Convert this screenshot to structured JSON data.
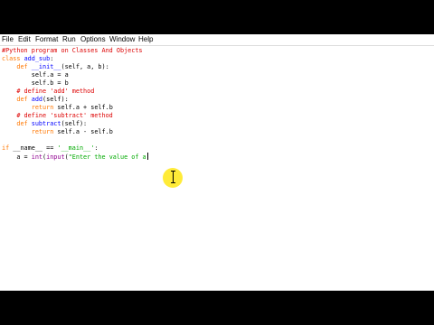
{
  "menu": {
    "items": [
      "File",
      "Edit",
      "Format",
      "Run",
      "Options",
      "Window",
      "Help"
    ]
  },
  "code": {
    "lines": [
      "#Python program on Classes And Objects",
      "class add_sub:",
      "    def __init__(self, a, b):",
      "        self.a = a",
      "        self.b = b",
      "    # define 'add' method",
      "    def add(self):",
      "        return self.a + self.b",
      "    # define 'subtract' method",
      "    def subtract(self):",
      "        return self.a - self.b",
      "",
      "if __name__ == '__main__':",
      "    a = int(input(\"Enter the value of a"
    ],
    "tokens": {
      "l0": "#Python program on Classes And Objects",
      "l1_kw": "class",
      "l1_name": "add_sub",
      "l1_rest": ":",
      "l2_indent": "    ",
      "l2_kw": "def",
      "l2_name": "__init__",
      "l2_rest": "(self, a, b):",
      "l3": "        self.a = a",
      "l4": "        self.b = b",
      "l5_indent": "    ",
      "l5_comment": "# define 'add' method",
      "l6_indent": "    ",
      "l6_kw": "def",
      "l6_name": "add",
      "l6_rest": "(self):",
      "l7_indent": "        ",
      "l7_kw": "return",
      "l7_rest": " self.a + self.b",
      "l8_indent": "    ",
      "l8_comment": "# define 'subtract' method",
      "l9_indent": "    ",
      "l9_kw": "def",
      "l9_name": "subtract",
      "l9_rest": "(self):",
      "l10_indent": "        ",
      "l10_kw": "return",
      "l10_rest": " self.a - self.b",
      "l12_kw": "if",
      "l12_mid": " __name__ == ",
      "l12_str": "'__main__'",
      "l12_rest": ":",
      "l13_indent": "    ",
      "l13_pre": "a = ",
      "l13_int": "int",
      "l13_paren": "(",
      "l13_input": "input",
      "l13_paren2": "(",
      "l13_str": "\"Enter the value of a"
    }
  },
  "colors": {
    "comment": "#dd0000",
    "keyword": "#ff7700",
    "definition": "#0000ff",
    "string": "#00aa00",
    "builtin": "#900090",
    "cursor_highlight": "#ffe600"
  },
  "icons": {
    "pointer": "ibeam-cursor-icon"
  }
}
